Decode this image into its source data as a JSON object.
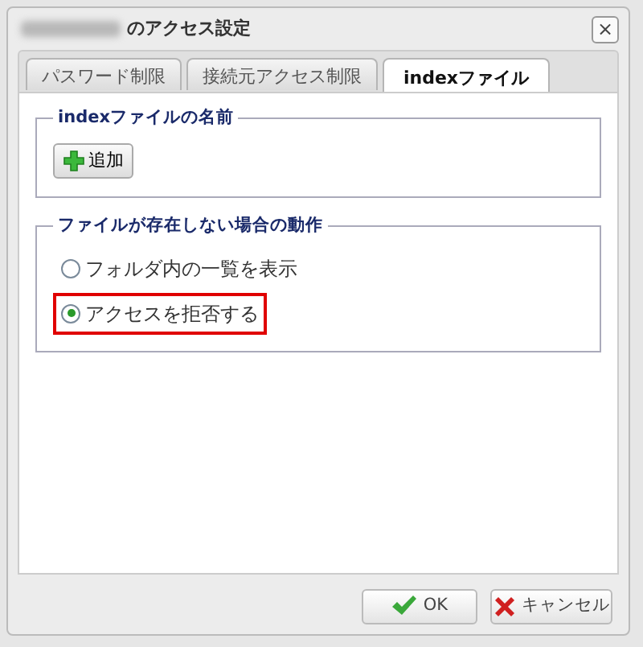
{
  "window": {
    "title": "のアクセス設定",
    "title_blurred_prefix": true,
    "close": "×"
  },
  "tabs": [
    {
      "label": "パスワード制限",
      "selected": false
    },
    {
      "label": "接続元アクセス制限",
      "selected": false
    },
    {
      "label": "indexファイル",
      "selected": true
    }
  ],
  "sections": [
    {
      "legend": "indexファイルの名前",
      "kind": "buttons",
      "buttons": [
        {
          "label": "追加",
          "kind": "plus"
        }
      ]
    },
    {
      "legend": "ファイルが存在しない場合の動作",
      "kind": "radios",
      "options": [
        {
          "label": "フォルダ内の一覧を表示",
          "selected": false,
          "highlighted": false
        },
        {
          "label": "アクセスを拒否する",
          "selected": true,
          "highlighted": true
        }
      ]
    }
  ],
  "buttons": [
    {
      "label": "OK",
      "kind": "check"
    },
    {
      "label": "キャンセル",
      "kind": "cross"
    }
  ]
}
